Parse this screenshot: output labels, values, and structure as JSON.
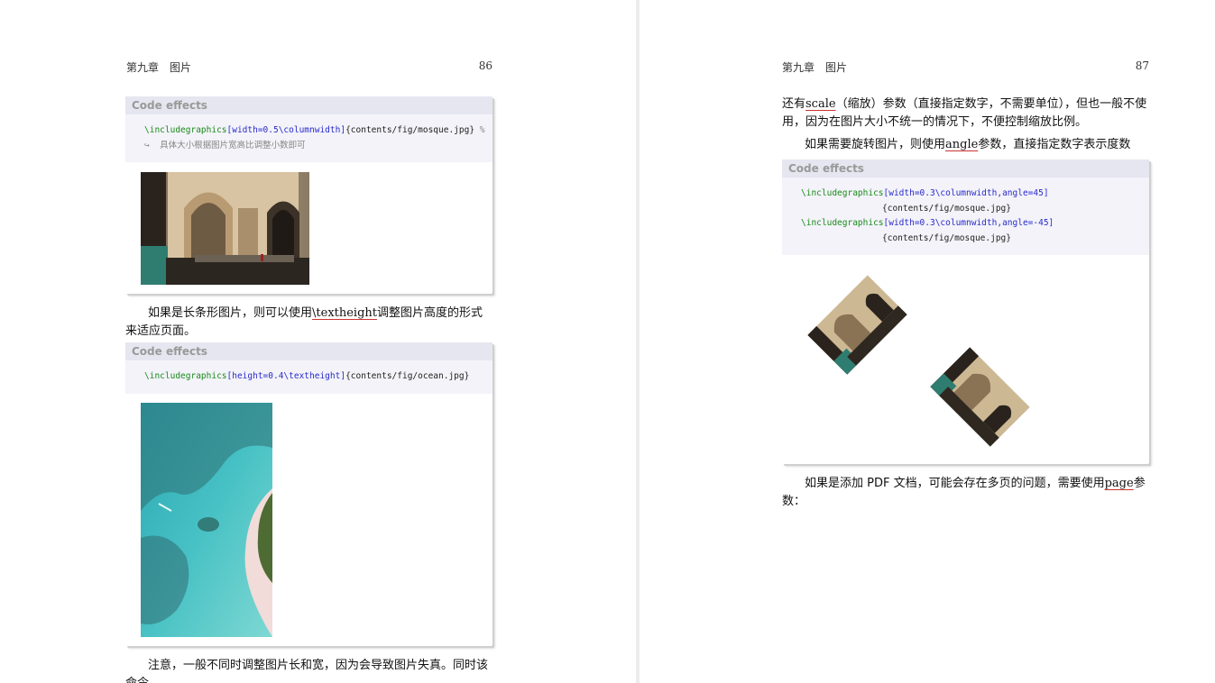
{
  "left_page": {
    "header": {
      "chapter": "第九章　图片",
      "page_number": "86"
    },
    "code_box_1": {
      "title": "Code effects",
      "cmd": "\\includegraphics",
      "opts": "[width=0.5\\columnwidth]",
      "arg": "{contents/fig/mosque.jpg}",
      "comment_mark": " %",
      "continuation": "↪  具体大小根据图片宽高比调整小数即可"
    },
    "para_1": {
      "before": "如果是长条形图片，则可以使用",
      "keyword": "\\textheight",
      "after": "调整图片高度的形式来适应页面。"
    },
    "code_box_2": {
      "title": "Code effects",
      "cmd": "\\includegraphics",
      "opts": "[height=0.4\\textheight]",
      "arg": "{contents/fig/ocean.jpg}"
    },
    "para_2": "注意，一般不同时调整图片长和宽，因为会导致图片失真。同时该命令"
  },
  "right_page": {
    "header": {
      "chapter": "第九章　图片",
      "page_number": "87"
    },
    "para_1": {
      "before": "还有",
      "keyword": "scale",
      "after": "（缩放）参数（直接指定数字，不需要单位），但也一般不使用，因为在图片大小不统一的情况下，不便控制缩放比例。"
    },
    "para_2": {
      "before": "如果需要旋转图片，则使用",
      "keyword": "angle",
      "after": "参数，直接指定数字表示度数"
    },
    "code_box": {
      "title": "Code effects",
      "line1_cmd": "\\includegraphics",
      "line1_opts": "[width=0.3\\columnwidth,angle=45]",
      "line2_arg": "{contents/fig/mosque.jpg}",
      "line3_cmd": "\\includegraphics",
      "line3_opts": "[width=0.3\\columnwidth,angle=-45]",
      "line4_arg": "{contents/fig/mosque.jpg}"
    },
    "para_3": {
      "before": "如果是添加 PDF 文档，可能会存在多页的问题，需要使用",
      "keyword": "page",
      "after": "参数："
    }
  }
}
